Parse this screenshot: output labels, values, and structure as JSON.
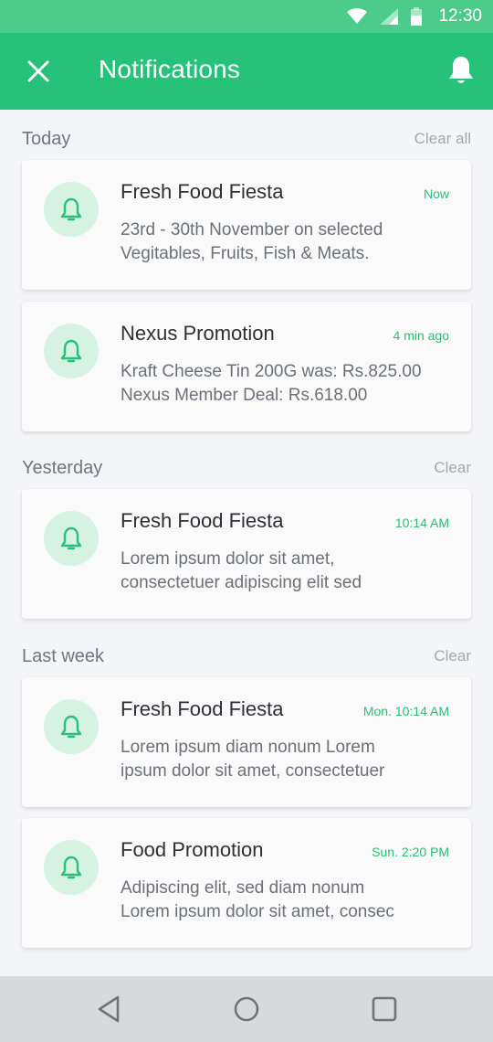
{
  "status_bar": {
    "time": "12:30",
    "icons": [
      "wifi-icon",
      "signal-icon",
      "battery-icon"
    ]
  },
  "app_bar": {
    "title": "Notifications",
    "close_icon": "close-icon",
    "bell_icon": "bell-icon"
  },
  "colors": {
    "status_bar": "#4ccb8b",
    "app_bar": "#27c27a",
    "accent": "#2bbd73",
    "avatar_bg": "#d6f2e3",
    "background": "#f3f5f8"
  },
  "sections": [
    {
      "label": "Today",
      "action": "Clear all",
      "items": [
        {
          "title": "Fresh Food Fiesta",
          "time": "Now",
          "line1": "23rd - 30th November on selected",
          "line2": "Vegitables, Fruits, Fish & Meats."
        },
        {
          "title": "Nexus Promotion",
          "time": "4 min ago",
          "line1": "Kraft Cheese Tin 200G was: Rs.825.00",
          "line2": "Nexus Member Deal: Rs.618.00"
        }
      ]
    },
    {
      "label": "Yesterday",
      "action": "Clear",
      "items": [
        {
          "title": "Fresh Food Fiesta",
          "time": "10:14 AM",
          "line1": "Lorem ipsum dolor sit amet,",
          "line2": "consectetuer adipiscing elit sed"
        }
      ]
    },
    {
      "label": "Last week",
      "action": "Clear",
      "items": [
        {
          "title": "Fresh Food Fiesta",
          "time": "Mon. 10:14 AM",
          "line1": "Lorem ipsum diam nonum Lorem",
          "line2": "ipsum dolor sit amet, consectetuer"
        },
        {
          "title": "Food Promotion",
          "time": "Sun. 2:20 PM",
          "line1": "Adipiscing elit, sed diam nonum",
          "line2": "Lorem ipsum dolor sit amet, consec"
        }
      ]
    }
  ],
  "nav_bar": {
    "buttons": [
      "back-icon",
      "home-icon",
      "recents-icon"
    ]
  }
}
